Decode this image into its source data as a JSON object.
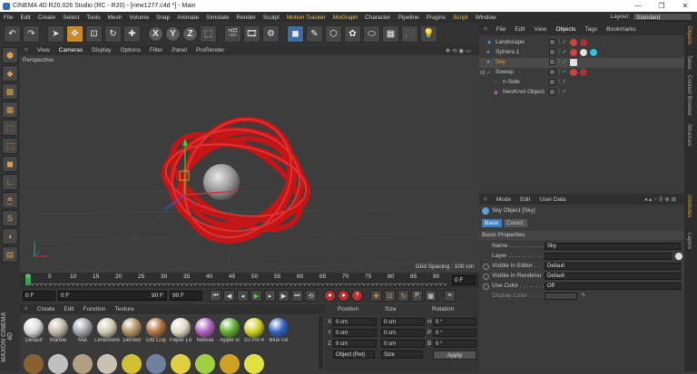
{
  "window": {
    "title": "CINEMA 4D R20.026 Studio (RC - R20) - [new1277.c4d *] - Main",
    "controls": [
      "—",
      "❐",
      "✕"
    ]
  },
  "menubar": {
    "items": [
      "File",
      "Edit",
      "Create",
      "Select",
      "Tools",
      "Mesh",
      "Volume",
      "Snap",
      "Animate",
      "Simulate",
      "Render",
      "Sculpt",
      "Motion Tracker",
      "MoGraph",
      "Character",
      "Pipeline",
      "Plugins",
      "Script",
      "Window"
    ],
    "layout_label": "Layout:",
    "layout_value": "Standard"
  },
  "toolbar": {
    "axis_letters": [
      "X",
      "Y",
      "Z"
    ]
  },
  "viewport": {
    "menu": [
      "View",
      "Cameras",
      "Display",
      "Options",
      "Filter",
      "Panel",
      "ProRender"
    ],
    "label": "Perspective",
    "grid_spacing": "Grid Spacing : 100 cm"
  },
  "timeline": {
    "ticks": [
      "0",
      "5",
      "10",
      "15",
      "20",
      "25",
      "30",
      "35",
      "40",
      "45",
      "50",
      "55",
      "60",
      "65",
      "70",
      "75",
      "80",
      "85",
      "90"
    ],
    "end_field": "0 F"
  },
  "transport": {
    "current_frame": "0 F",
    "start_frame": "0 F",
    "range_end": "90 F",
    "end_frame": "90 F"
  },
  "materials": {
    "menu": [
      "Create",
      "Edit",
      "Function",
      "Texture"
    ],
    "items": [
      {
        "label": "Default",
        "color": "#d8d8d8"
      },
      {
        "label": "Marble",
        "color": "#c0b8a8"
      },
      {
        "label": "Mat",
        "color": "#a0a4a8"
      },
      {
        "label": "Limestone",
        "color": "#d0c8b0"
      },
      {
        "label": "Dented",
        "color": "#b09060"
      },
      {
        "label": "Old Cop",
        "color": "#b07040"
      },
      {
        "label": "Paper Lo",
        "color": "#e0d8c0"
      },
      {
        "label": "Nebula",
        "color": "#b060c0"
      },
      {
        "label": "Apple sl",
        "color": "#60b030"
      },
      {
        "label": "10 Pin 4",
        "color": "#d0d020"
      },
      {
        "label": "Blue Gli",
        "color": "#3060c0"
      }
    ]
  },
  "coords": {
    "headers": [
      "Position",
      "Size",
      "Rotation"
    ],
    "rows": [
      {
        "axis": "X",
        "pos": "0 cm",
        "size": "0 cm",
        "rot_axis": "H",
        "rot": "0 °"
      },
      {
        "axis": "Y",
        "pos": "0 cm",
        "size": "0 cm",
        "rot_axis": "P",
        "rot": "0 °"
      },
      {
        "axis": "Z",
        "pos": "0 cm",
        "size": "0 cm",
        "rot_axis": "B",
        "rot": "0 °"
      }
    ],
    "mode": "Object (Rel)",
    "size_mode": "Size",
    "apply": "Apply"
  },
  "objects": {
    "tabs": [
      "File",
      "Edit",
      "View",
      "Objects",
      "Tags",
      "Bookmarks"
    ],
    "active_tab": "Objects",
    "items": [
      {
        "name": "Landscape",
        "indent": 0
      },
      {
        "name": "Sphere.1",
        "indent": 0
      },
      {
        "name": "Sky",
        "indent": 0
      },
      {
        "name": "Sweep",
        "indent": 0
      },
      {
        "name": "n-Side",
        "indent": 1
      },
      {
        "name": "NeoKnot Object",
        "indent": 1
      }
    ]
  },
  "attributes": {
    "menu": [
      "Mode",
      "Edit",
      "User Data"
    ],
    "object_title": "Sky Object [Sky]",
    "tabs": [
      "Basic",
      "Coord."
    ],
    "section": "Basic Properties",
    "fields": [
      {
        "label": "Name . . . . . . . . . . .",
        "value": "Sky"
      },
      {
        "label": "Layer . . . . . . . . . . .",
        "value": ""
      },
      {
        "label": "Visible in Editor . .",
        "value": "Default"
      },
      {
        "label": "Visible in Renderer",
        "value": "Default"
      },
      {
        "label": "Use Color . . . . . . . .",
        "value": "Off"
      },
      {
        "label": "Display Color . . . . .",
        "value": ""
      }
    ]
  },
  "side_tabs": [
    "Objects",
    "Takes",
    "Content Browser",
    "Structure",
    "Attributes",
    "Layers"
  ]
}
